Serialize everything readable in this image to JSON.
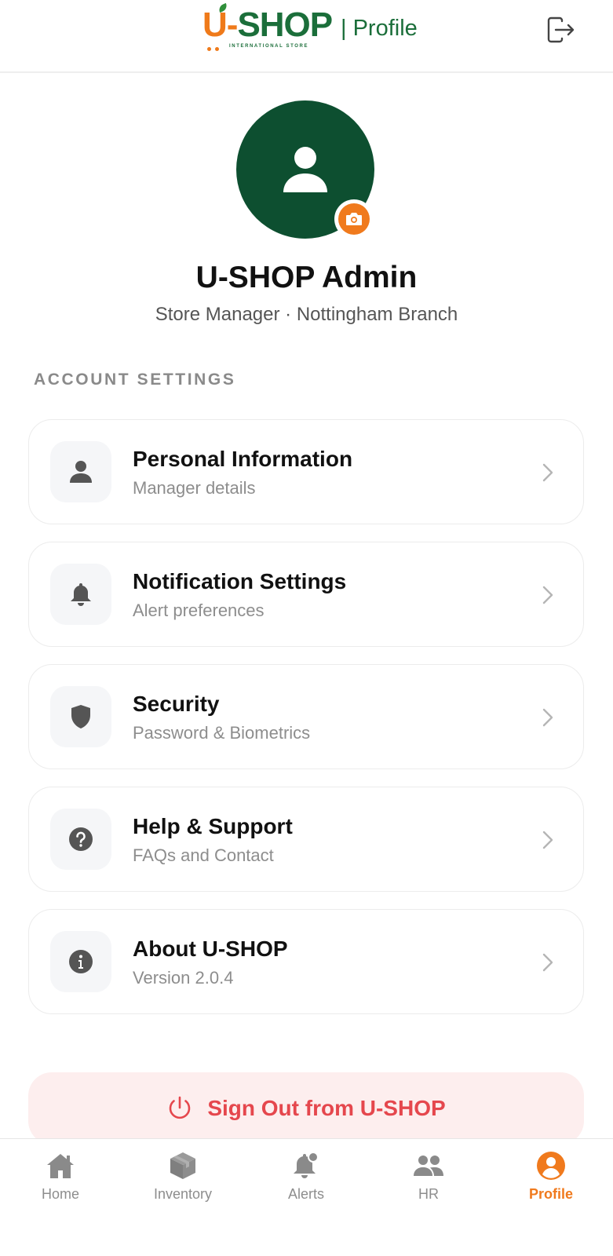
{
  "header": {
    "logo_letter_u": "U",
    "logo_dash": "-",
    "logo_shop": "SHOP",
    "logo_tagline": "INTERNATIONAL STORE",
    "page_title": "| Profile",
    "logout_icon": "logout-icon"
  },
  "profile": {
    "avatar_icon": "user-icon",
    "camera_icon": "camera-icon",
    "name": "U-SHOP Admin",
    "role": "Store Manager · Nottingham Branch"
  },
  "settings": {
    "section_title": "ACCOUNT SETTINGS",
    "items": [
      {
        "title": "Personal Information",
        "subtitle": "Manager details",
        "icon": "person-icon"
      },
      {
        "title": "Notification Settings",
        "subtitle": "Alert preferences",
        "icon": "bell-icon"
      },
      {
        "title": "Security",
        "subtitle": "Password & Biometrics",
        "icon": "shield-icon"
      },
      {
        "title": "Help & Support",
        "subtitle": "FAQs and Contact",
        "icon": "help-icon"
      },
      {
        "title": "About U-SHOP",
        "subtitle": "Version 2.0.4",
        "icon": "info-icon"
      }
    ]
  },
  "signout": {
    "label": "Sign Out from U-SHOP",
    "icon": "power-icon"
  },
  "nav": {
    "items": [
      {
        "label": "Home",
        "icon": "home-icon"
      },
      {
        "label": "Inventory",
        "icon": "box-icon"
      },
      {
        "label": "Alerts",
        "icon": "bell-alert-icon"
      },
      {
        "label": "HR",
        "icon": "people-icon"
      },
      {
        "label": "Profile",
        "icon": "profile-icon"
      }
    ],
    "active": "Profile"
  },
  "colors": {
    "brand_green": "#1b6e3a",
    "avatar_green": "#0d4f30",
    "brand_orange": "#f07a1d",
    "danger_red": "#e5474d",
    "danger_bg": "#fdeeee"
  }
}
